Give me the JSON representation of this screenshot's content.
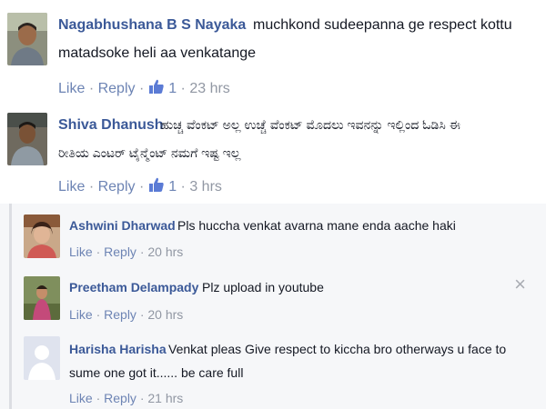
{
  "comments": [
    {
      "name": "Nagabhushana B S Nayaka",
      "text_line1": "muchkond sudeepanna ge respect kottu",
      "text_line2": "matadsoke heli aa venkatange",
      "like_label": "Like",
      "reply_label": "Reply",
      "like_count": "1",
      "time": "23 hrs"
    },
    {
      "name": "Shiva Dhanush",
      "text_line1": "ಹುಚ್ಚ ವೆಂಕಟ್ ಅಲ್ಲ ಉಚ್ಚೆ ವೆಂಕಟ್ ಮೊದಲು ಇವನನ್ನು ಇಲ್ಲಿಂದ ಓಡಿಸಿ ಈ",
      "text_line2": "ರೀತಿಯ ಎಂಟರ್ ಟೈನ್ಮೆಂಟ್ ನಮಗೆ ಇಷ್ಟ ಇಲ್ಲ",
      "like_label": "Like",
      "reply_label": "Reply",
      "like_count": "1",
      "time": "3 hrs"
    }
  ],
  "replies": [
    {
      "name": "Ashwini Dharwad",
      "text": "Pls huccha venkat avarna mane enda aache haki",
      "like_label": "Like",
      "reply_label": "Reply",
      "time": "20 hrs"
    },
    {
      "name": "Preetham Delampady",
      "text": "Plz upload in youtube",
      "like_label": "Like",
      "reply_label": "Reply",
      "time": "20 hrs"
    },
    {
      "name": "Harisha Harisha",
      "text_line1": "Venkat pleas Give respect to kiccha bro otherways u face to",
      "text_line2": "sume one got it...... be care full",
      "like_label": "Like",
      "reply_label": "Reply",
      "time": "21 hrs"
    }
  ],
  "close_glyph": "×",
  "separator": "·"
}
